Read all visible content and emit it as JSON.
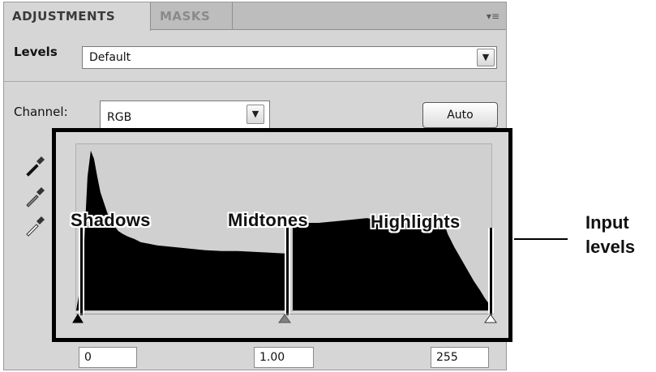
{
  "panel": {
    "tabs": [
      {
        "label": "ADJUSTMENTS",
        "active": true
      },
      {
        "label": "MASKS",
        "active": false
      }
    ],
    "menu_icon": "panel-menu-icon",
    "levels_label": "Levels",
    "preset_value": "Default",
    "channel_label": "Channel:",
    "channel_value": "RGB",
    "auto_label": "Auto",
    "eyedroppers": [
      "black-point-eyedropper-icon",
      "gray-point-eyedropper-icon",
      "white-point-eyedropper-icon"
    ],
    "inputs": {
      "shadows": "0",
      "midtones": "1.00",
      "highlights": "255"
    }
  },
  "histogram": {
    "labels": {
      "shadows": "Shadows",
      "midtones": "Midtones",
      "highlights": "Highlights"
    },
    "slider_levels": {
      "shadows": 0,
      "midtones": 1.0,
      "highlights": 255
    }
  },
  "callout": {
    "line1": "Input",
    "line2": "levels"
  },
  "colors": {
    "panel": "#d6d6d6",
    "histogram_fill": "#000000",
    "frame": "#000000"
  }
}
